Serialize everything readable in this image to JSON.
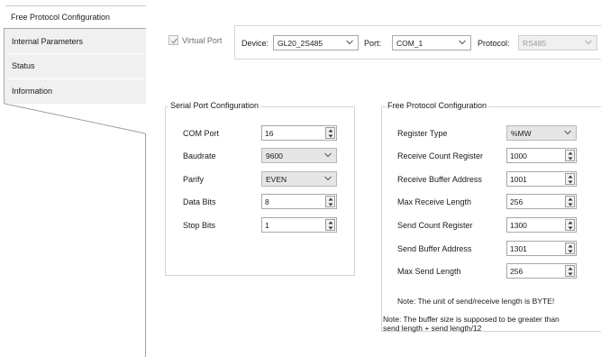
{
  "tabs": {
    "active": "Free Protocol Configuration",
    "items": [
      "Internal Parameters",
      "Status",
      "Information"
    ]
  },
  "topbar": {
    "virtual_port_label": "Virtual Port",
    "virtual_port_checked": true,
    "device_label": "Device:",
    "device_value": "GL20_2S485",
    "port_label": "Port:",
    "port_value": "COM_1",
    "protocol_label": "Protocol:",
    "protocol_value": "RS485"
  },
  "serial": {
    "title": "Serial Port Configuration",
    "com_port": {
      "label": "COM Port",
      "value": "16"
    },
    "baudrate": {
      "label": "Baudrate",
      "value": "9600"
    },
    "parity": {
      "label": "Parify",
      "value": "EVEN"
    },
    "data_bits": {
      "label": "Data Bits",
      "value": "8"
    },
    "stop_bits": {
      "label": "Stop Bits",
      "value": "1"
    }
  },
  "free": {
    "title": "Free Protocol Configuration",
    "register_type": {
      "label": "Register Type",
      "value": "%MW"
    },
    "receive_count_register": {
      "label": "Receive Count Register",
      "value": "1000"
    },
    "receive_buffer_address": {
      "label": "Receive Buffer Address",
      "value": "1001"
    },
    "max_receive_length": {
      "label": "Max Receive Length",
      "value": "256"
    },
    "send_count_register": {
      "label": "Send Count Register",
      "value": "1300"
    },
    "send_buffer_address": {
      "label": "Send Buffer Address",
      "value": "1301"
    },
    "max_send_length": {
      "label": "Max Send Length",
      "value": "256"
    },
    "note_unit": "Note: The unit of send/receive length is BYTE!",
    "note_buffer_line1": "Note: The buffer size is supposed to be greater than",
    "note_buffer_line2": "send length + send length/12"
  }
}
